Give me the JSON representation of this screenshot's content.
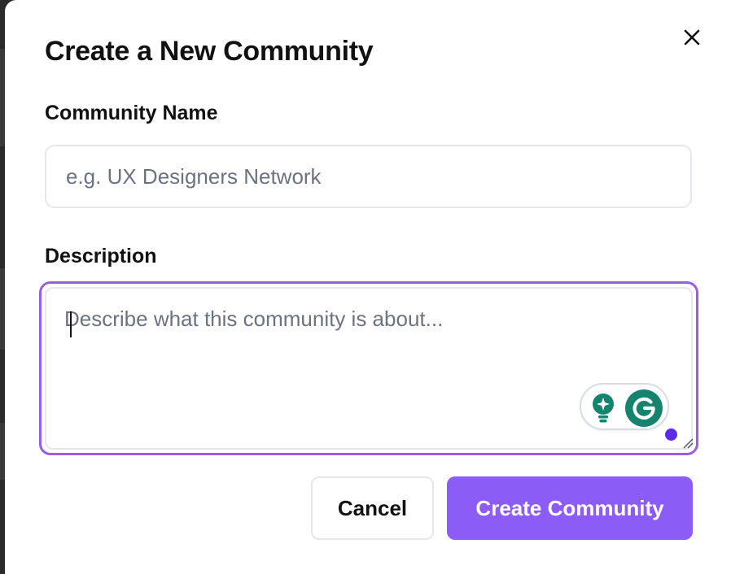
{
  "dialog": {
    "title": "Create a New Community",
    "close_icon": "close-icon"
  },
  "form": {
    "name": {
      "label": "Community Name",
      "value": "",
      "placeholder": "e.g. UX Designers Network"
    },
    "description": {
      "label": "Description",
      "value": "",
      "placeholder": "Describe what this community is about..."
    }
  },
  "grammarly": {
    "suggestion_icon": "lightbulb-sparkle-icon",
    "logo_icon": "grammarly-g-icon"
  },
  "actions": {
    "cancel_label": "Cancel",
    "create_label": "Create Community"
  },
  "colors": {
    "accent": "#8b5cf6",
    "focus_ring": "#9b5de5",
    "grammarly_green": "#15836d",
    "status_dot": "#5b2cf0"
  }
}
